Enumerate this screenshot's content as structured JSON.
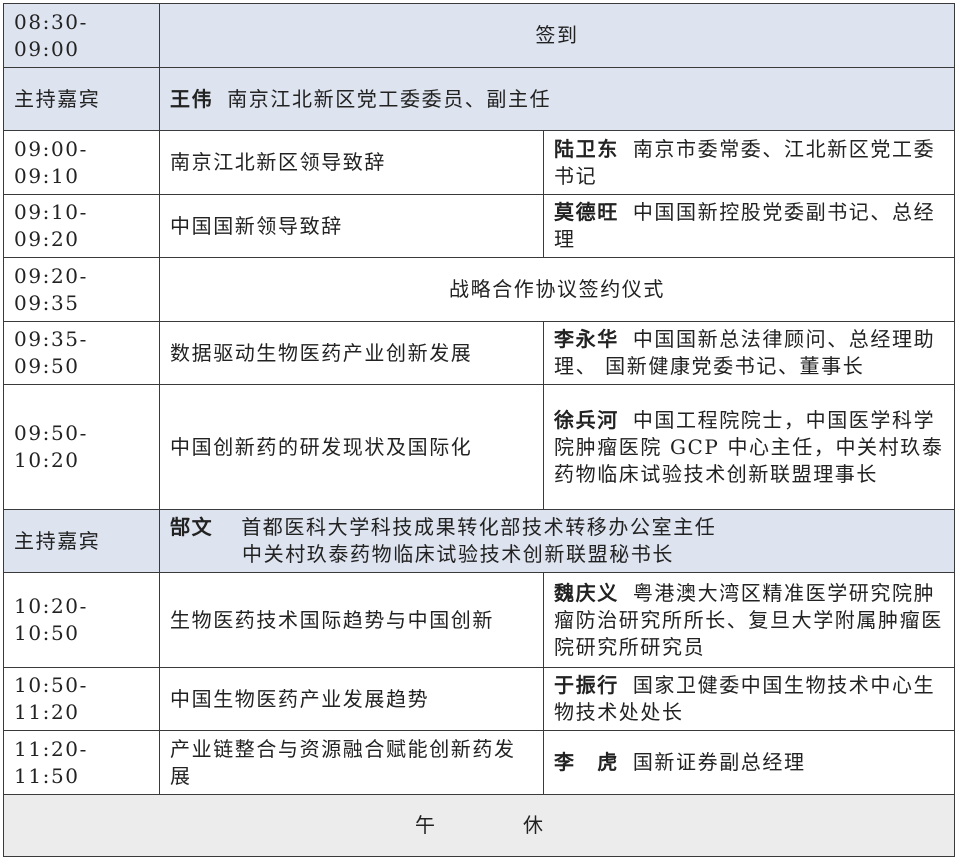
{
  "rows": [
    {
      "time": "08:30-09:00",
      "title": "签到"
    },
    {
      "time": "主持嘉宾",
      "host_name": "王伟",
      "host_title": "南京江北新区党工委委员、副主任"
    },
    {
      "time": "09:00-09:10",
      "topic": "南京江北新区领导致辞",
      "speaker": "陆卫东",
      "speaker_title": "南京市委常委、江北新区党工委书记"
    },
    {
      "time": "09:10-09:20",
      "topic": "中国国新领导致辞",
      "speaker": "莫德旺",
      "speaker_title": "中国国新控股党委副书记、总经理"
    },
    {
      "time": "09:20-09:35",
      "title": "战略合作协议签约仪式"
    },
    {
      "time": "09:35-09:50",
      "topic": "数据驱动生物医药产业创新发展",
      "speaker": "李永华",
      "speaker_title": "中国国新总法律顾问、总经理助理、 国新健康党委书记、董事长"
    },
    {
      "time": "09:50-10:20",
      "topic": "中国创新药的研发现状及国际化",
      "speaker": "徐兵河",
      "speaker_title": "中国工程院院士，中国医学科学院肿瘤医院 GCP 中心主任，中关村玖泰药物临床试验技术创新联盟理事长"
    },
    {
      "time": "主持嘉宾",
      "host_name": "郜文",
      "host_title": "首都医科大学科技成果转化部技术转移办公室主任",
      "host_title_2": "中关村玖泰药物临床试验技术创新联盟秘书长"
    },
    {
      "time": "10:20-10:50",
      "topic": "生物医药技术国际趋势与中国创新",
      "speaker": "魏庆义",
      "speaker_title": "粤港澳大湾区精准医学研究院肿瘤防治研究所所长、复旦大学附属肿瘤医院研究所研究员"
    },
    {
      "time": "10:50-11:20",
      "topic": "中国生物医药产业发展趋势",
      "speaker": "于振行",
      "speaker_title": "国家卫健委中国生物技术中心生物技术处处长"
    },
    {
      "time": "11:20-11:50",
      "topic": "产业链整合与资源融合赋能创新药发展",
      "speaker": "李　虎",
      "speaker_title": "国新证券副总经理"
    },
    {
      "title": "午　休"
    }
  ]
}
